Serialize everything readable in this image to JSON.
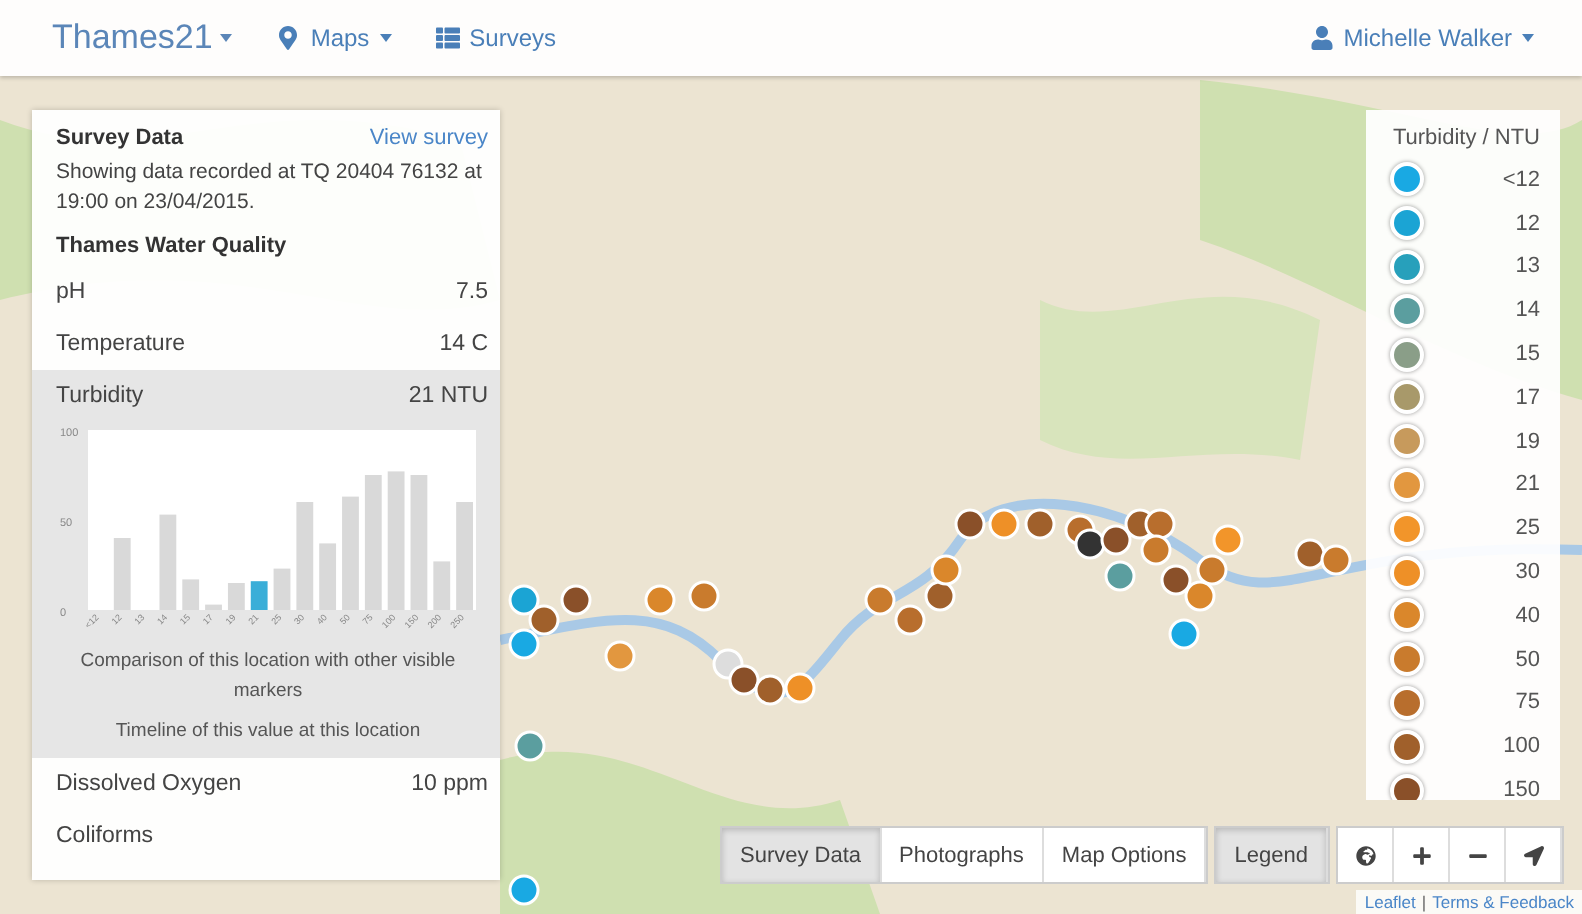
{
  "navbar": {
    "brand": "Thames21",
    "menu": [
      {
        "kind": "maps",
        "label": "Maps",
        "dropdown": true
      },
      {
        "kind": "surveys",
        "label": "Surveys",
        "dropdown": false
      }
    ],
    "user": "Michelle Walker"
  },
  "panel": {
    "title": "Survey Data",
    "link": "View survey",
    "description": "Showing data recorded at TQ 20404 76132 at 19:00 on 23/04/2015.",
    "section": "Thames Water Quality",
    "rows": [
      {
        "label": "pH",
        "value": "7.5",
        "expanded": false
      },
      {
        "label": "Temperature",
        "value": "14 C",
        "expanded": false
      },
      {
        "label": "Turbidity",
        "value": "21 NTU",
        "expanded": true,
        "chart_data": {
          "type": "bar",
          "categories": [
            "<12",
            "12",
            "13",
            "14",
            "15",
            "17",
            "19",
            "21",
            "25",
            "30",
            "40",
            "50",
            "75",
            "100",
            "150",
            "200",
            "250"
          ],
          "ylim": [
            0,
            100
          ],
          "yticks": [
            0,
            50,
            100
          ],
          "series": [
            {
              "color": "#d9d9d9",
              "values": [
                0,
                40,
                0,
                53,
                17,
                3,
                15,
                null,
                23,
                60,
                37,
                63,
                75,
                77,
                75,
                27,
                60
              ]
            },
            {
              "color": "#3aaed8",
              "values": [
                null,
                null,
                null,
                null,
                null,
                null,
                null,
                16,
                null,
                null,
                null,
                null,
                null,
                null,
                null,
                null,
                null
              ]
            }
          ]
        },
        "caption": "Comparison of this location with other visible markers",
        "timeline": "Timeline of this value at this location"
      },
      {
        "label": "Dissolved Oxygen",
        "value": "10 ppm",
        "expanded": false
      },
      {
        "label": "Coliforms",
        "expanded": false
      }
    ]
  },
  "legend": {
    "title": "Turbidity / NTU",
    "items": [
      {
        "label": "<12",
        "color": "#19a9e3"
      },
      {
        "label": "12",
        "color": "#1ba4d4"
      },
      {
        "label": "13",
        "color": "#27a0bb"
      },
      {
        "label": "14",
        "color": "#5b9e9f"
      },
      {
        "label": "15",
        "color": "#8a9e88"
      },
      {
        "label": "17",
        "color": "#a8996a"
      },
      {
        "label": "19",
        "color": "#c79a5c"
      },
      {
        "label": "21",
        "color": "#e2973f"
      },
      {
        "label": "25",
        "color": "#f2952a"
      },
      {
        "label": "30",
        "color": "#ee9027"
      },
      {
        "label": "40",
        "color": "#da872b"
      },
      {
        "label": "50",
        "color": "#c97b2d"
      },
      {
        "label": "75",
        "color": "#b86e2d"
      },
      {
        "label": "100",
        "color": "#a0602b"
      },
      {
        "label": "150",
        "color": "#8a5029"
      }
    ]
  },
  "toolbar": {
    "tabs": [
      {
        "label": "Survey Data",
        "selected": true
      },
      {
        "label": "Photographs",
        "selected": false
      },
      {
        "label": "Map Options",
        "selected": false
      }
    ],
    "legend_toggle": {
      "label": "Legend",
      "selected": true
    },
    "tools": [
      {
        "kind": "globe"
      },
      {
        "kind": "zoom-in"
      },
      {
        "kind": "zoom-out"
      },
      {
        "kind": "locate"
      }
    ]
  },
  "attribution": {
    "links": [
      {
        "label": "Leaflet"
      },
      {
        "label": "Terms & Feedback"
      }
    ],
    "separator": "|"
  }
}
